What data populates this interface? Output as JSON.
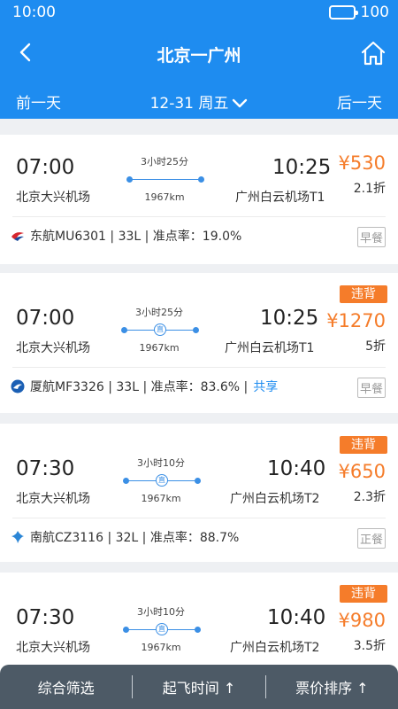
{
  "status": {
    "time": "10:00",
    "battery": "100"
  },
  "header": {
    "route": "北京一广州",
    "prev_day": "前一天",
    "date": "12-31 周五",
    "next_day": "后一天"
  },
  "flights": [
    {
      "dep_time": "07:00",
      "dep_airport": "北京大兴机场",
      "duration": "3小时25分",
      "direct": "直",
      "distance": "1967km",
      "arr_time": "10:25",
      "arr_airport": "广州白云机场T1",
      "price": "¥530",
      "discount": "2.1折",
      "airline_text": "东航MU6301 | 33L | 准点率：19.0%",
      "share": "",
      "meal": "早餐",
      "tag": ""
    },
    {
      "dep_time": "07:00",
      "dep_airport": "北京大兴机场",
      "duration": "3小时25分",
      "direct": "直",
      "distance": "1967km",
      "arr_time": "10:25",
      "arr_airport": "广州白云机场T1",
      "price": "¥1270",
      "discount": "5折",
      "airline_text": "厦航MF3326 | 33L | 准点率：83.6% |",
      "share": "共享",
      "meal": "早餐",
      "tag": "违背"
    },
    {
      "dep_time": "07:30",
      "dep_airport": "北京大兴机场",
      "duration": "3小时10分",
      "direct": "直",
      "distance": "1967km",
      "arr_time": "10:40",
      "arr_airport": "广州白云机场T2",
      "price": "¥650",
      "discount": "2.3折",
      "airline_text": "南航CZ3116 | 32L | 准点率：88.7%",
      "share": "",
      "meal": "正餐",
      "tag": "违背"
    },
    {
      "dep_time": "07:30",
      "dep_airport": "北京大兴机场",
      "duration": "3小时10分",
      "direct": "直",
      "distance": "1967km",
      "arr_time": "10:40",
      "arr_airport": "广州白云机场T2",
      "price": "¥980",
      "discount": "3.5折",
      "airline_text": "",
      "share": "",
      "meal": "",
      "tag": "违背"
    }
  ],
  "bottombar": {
    "filter": "综合筛选",
    "departure": "起飞时间 ↑",
    "price_sort": "票价排序 ↑"
  },
  "colors": {
    "primary": "#1e8cf0",
    "price": "#f57c2a",
    "bottombar": "#4d5a66"
  },
  "icons": {
    "back": "chevron-left-icon",
    "home": "home-icon",
    "date_dropdown": "chevron-down-icon"
  }
}
